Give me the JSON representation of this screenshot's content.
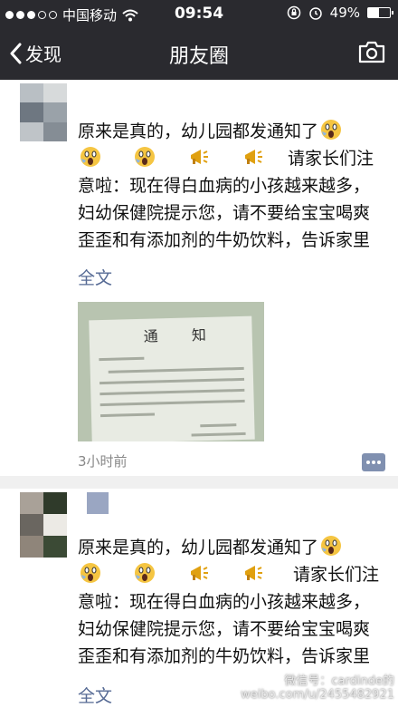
{
  "status_bar": {
    "carrier": "中国移动",
    "time": "09:54",
    "battery": "49%",
    "battery_level": 0.49,
    "signal_filled": 3,
    "signal_total": 5
  },
  "nav": {
    "back_label": "发现",
    "title": "朋友圈"
  },
  "posts": [
    {
      "text_parts": [
        "原来是真的，幼儿园都发通知了",
        "请家长们注意啦：现在得白血病的小孩越来越多，妇幼保健院提示您，请不要给宝宝喝爽歪歪和有添加剂的牛奶饮料，告诉家里有小孩的朋友，旺仔牛"
      ],
      "full_text_label": "全文",
      "photo_title": "通 知",
      "time_ago": "3小时前"
    },
    {
      "text_parts": [
        "原来是真的，幼儿园都发通知了",
        "请家长们注意啦：现在得白血病的小孩越来越多，妇幼保健院提示您，请不要给宝宝喝爽歪歪和有添加剂的牛奶饮料，告诉家里有小孩的朋友，旺仔牛奶"
      ],
      "full_text_label": "全文"
    }
  ],
  "watermark": {
    "line1": "微信号：cardinde的",
    "line2": "weibo.com/u/2455482921"
  },
  "colors": {
    "bar_background": "#2a2a2f",
    "link": "#576b95",
    "muted": "#888888"
  }
}
